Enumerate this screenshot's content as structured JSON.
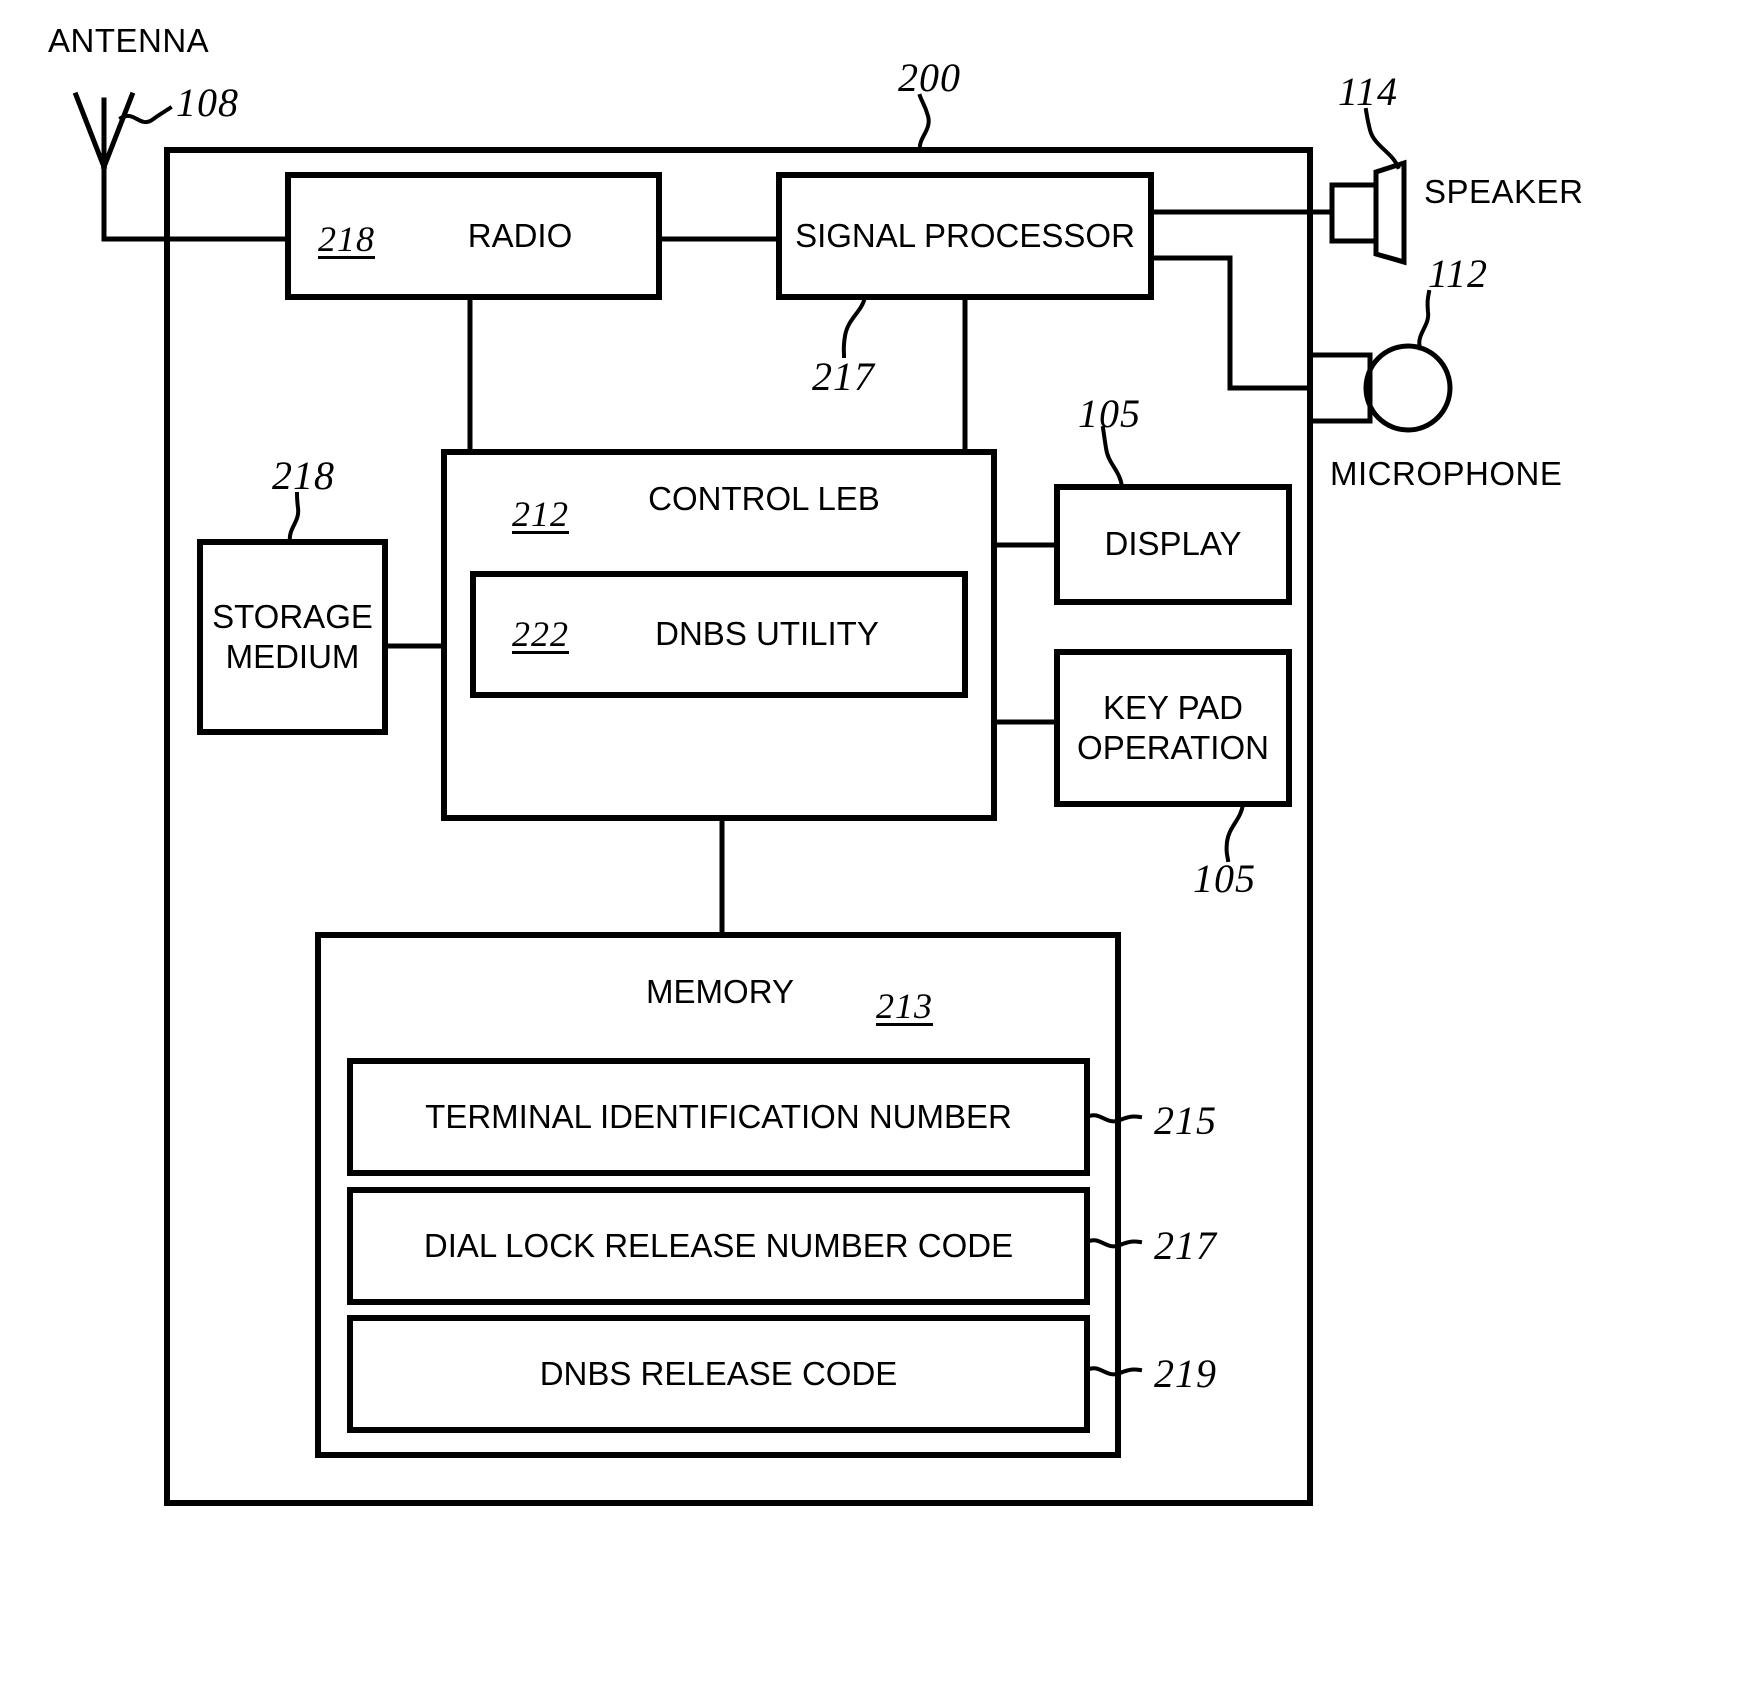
{
  "figure": {
    "title": "Mobile terminal block diagram",
    "system_ref": "200",
    "line_color": "#000000",
    "background": "#ffffff"
  },
  "external_components": [
    {
      "name": "antenna",
      "label": "ANTENNA",
      "ref": "108"
    },
    {
      "name": "speaker",
      "label": "SPEAKER",
      "ref": "114"
    },
    {
      "name": "microphone",
      "label": "MICROPHONE",
      "ref": "112"
    }
  ],
  "blocks": {
    "radio": {
      "label": "RADIO",
      "ref": "218"
    },
    "signal_processor": {
      "label": "SIGNAL PROCESSOR",
      "ref": "217"
    },
    "storage_medium": {
      "label_line1": "STORAGE",
      "label_line2": "MEDIUM",
      "ref": "218"
    },
    "control_leb": {
      "label": "CONTROL LEB",
      "ref": "212"
    },
    "dnbs_utility": {
      "label": "DNBS UTILITY",
      "ref": "222"
    },
    "display": {
      "label": "DISPLAY",
      "ref": "105"
    },
    "key_pad": {
      "label_line1": "KEY PAD",
      "label_line2": "OPERATION",
      "ref": "105"
    },
    "memory": {
      "label": "MEMORY",
      "ref": "213"
    }
  },
  "memory_items": [
    {
      "label": "TERMINAL IDENTIFICATION NUMBER",
      "ref": "215"
    },
    {
      "label": "DIAL LOCK RELEASE NUMBER CODE",
      "ref": "217"
    },
    {
      "label": "DNBS RELEASE CODE",
      "ref": "219"
    }
  ]
}
